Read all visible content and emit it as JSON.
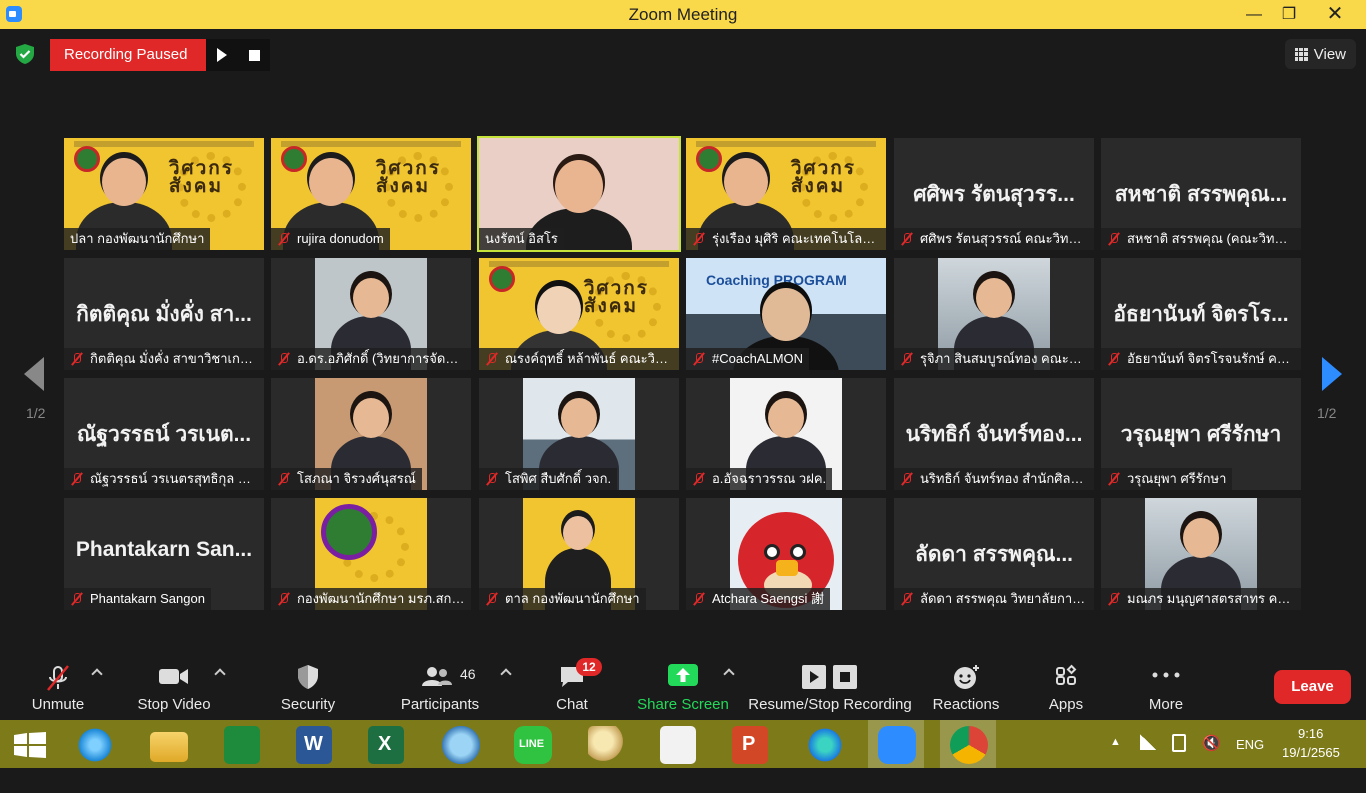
{
  "window": {
    "title": "Zoom Meeting"
  },
  "recording": {
    "status": "Recording Paused"
  },
  "view_button": {
    "label": "View"
  },
  "pagination": {
    "left": "1/2",
    "right": "1/2"
  },
  "tiles": [
    {
      "label": "ปลา กองพัฒนานักศึกษา",
      "muted": false,
      "video": true
    },
    {
      "label": "rujira donudom",
      "muted": true,
      "video": true
    },
    {
      "label": "นงรัตน์ อิสโร",
      "muted": false,
      "video": true,
      "active": true
    },
    {
      "label": "รุ่งเรือง มุศิริ คณะเทคโนโลยีอุตส...",
      "muted": true,
      "video": true
    },
    {
      "name": "ศศิพร รัตนสุวรร...",
      "label": "ศศิพร รัตนสุวรรณ์ คณะวิทยาศ...",
      "muted": true,
      "video": false
    },
    {
      "name": "สหชาติ สรรพคุณ...",
      "label": "สหชาติ สรรพคุณ (คณะวิทยาศ...",
      "muted": true,
      "video": false
    },
    {
      "name": "กิตติคุณ  มั่งคั่ง สา...",
      "label": "กิตติคุณ  มั่งคั่ง สาขาวิชาเกษตร...",
      "muted": true,
      "video": false
    },
    {
      "label": "อ.ดร.อภิศักดิ์ (วิทยาการจัดการ)",
      "muted": true,
      "video": true
    },
    {
      "label": "ณรงค์ฤทธิ์ หล้าพันธ์ คณะวิทยาการ...",
      "muted": true,
      "video": true
    },
    {
      "label": "#CoachALMON",
      "muted": true,
      "video": true
    },
    {
      "label": "รุจิภา สินสมบูรณ์ทอง คณะวิทยา...",
      "muted": true,
      "video": true
    },
    {
      "name": "อัธยานันท์ จิตรโร...",
      "label": "อัธยานันท์ จิตรโรจนรักษ์ คณะ...",
      "muted": true,
      "video": false
    },
    {
      "name": "ณัฐวรรธน์ วรเนต...",
      "label": "ณัฐวรรธน์ วรเนตรสุทธิกุล คณะ...",
      "muted": true,
      "video": false
    },
    {
      "label": "โสภณา จิรวงศ์นุสรณ์",
      "muted": true,
      "video": true
    },
    {
      "label": "โสพิศ สืบศักดิ์ วจก.",
      "muted": true,
      "video": true
    },
    {
      "label": "อ.อัจฉราวรรณ วฝค.",
      "muted": true,
      "video": true
    },
    {
      "name": "นริทธิก์ จันทร์ทอง...",
      "label": "นริทธิก์ จันทร์ทอง สำนักศิลปะ...",
      "muted": true,
      "video": false
    },
    {
      "name": "วรุณยุพา ศรีรักษา",
      "label": "วรุณยุพา ศรีรักษา",
      "muted": true,
      "video": false
    },
    {
      "name": "Phantakarn  San...",
      "label": "Phantakarn Sangon",
      "muted": true,
      "video": false
    },
    {
      "label": "กองพัฒนานักศึกษา มรภ.สกลนคร",
      "muted": true,
      "video": true
    },
    {
      "label": "ตาล กองพัฒนานักศึกษา",
      "muted": true,
      "video": true
    },
    {
      "label": "Atchara Saengsi 謝",
      "muted": true,
      "video": true
    },
    {
      "name": "ลัดดา สรรพคุณ...",
      "label": "ลัดดา สรรพคุณ  วิทยาลัยการ...",
      "muted": true,
      "video": false
    },
    {
      "label": "มณภร มนุญศาสตรสาทร คณะ...",
      "muted": true,
      "video": true
    }
  ],
  "video_text": {
    "yellow_logo": "วิศวกร\nสังคม",
    "coach_banner": "Coaching PROGRAM"
  },
  "toolbar": {
    "unmute": "Unmute",
    "stop_video": "Stop Video",
    "security": "Security",
    "participants": "Participants",
    "participants_count": "46",
    "chat": "Chat",
    "chat_badge": "12",
    "share_screen": "Share Screen",
    "resume_stop_recording": "Resume/Stop Recording",
    "reactions": "Reactions",
    "apps": "Apps",
    "more": "More",
    "leave": "Leave"
  },
  "taskbar": {
    "time": "9:16",
    "date": "19/1/2565",
    "lang": "ENG",
    "icons": [
      "windows-start",
      "internet-explorer",
      "file-explorer",
      "microsoft-store",
      "word",
      "excel",
      "math-input",
      "line",
      "paint",
      "lisrel",
      "powerpoint",
      "edge",
      "zoom",
      "chrome"
    ]
  },
  "colors": {
    "accent_blue": "#2d8cff",
    "record_red": "#e02828",
    "share_green": "#23d959",
    "active_speaker": "#c5e33a",
    "title_bar": "#f9d849"
  }
}
